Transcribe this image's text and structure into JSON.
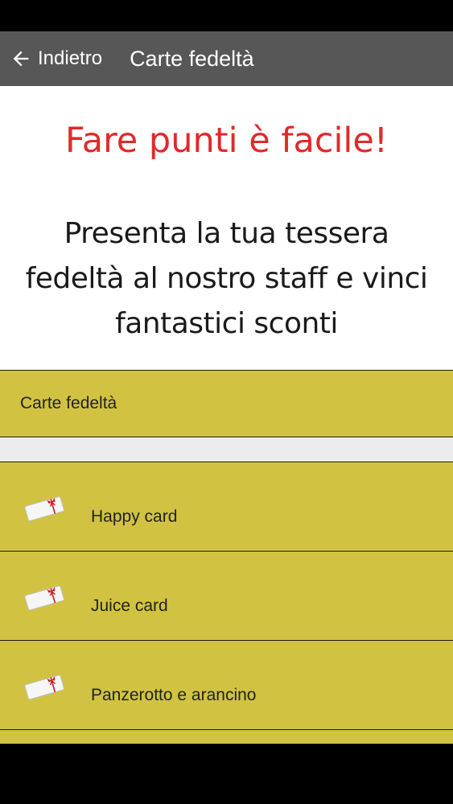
{
  "app_bar": {
    "back_label": "Indietro",
    "title": "Carte fedeltà"
  },
  "banner": {
    "headline": "Fare punti è facile!",
    "body": "Presenta la tua tessera fedeltà al nostro staff e vinci fantastici sconti"
  },
  "section_header": {
    "label": "Carte fedeltà"
  },
  "cards": [
    {
      "label": "Happy card",
      "icon": "gift-card-icon"
    },
    {
      "label": "Juice card",
      "icon": "gift-card-icon"
    },
    {
      "label": "Panzerotto e arancino",
      "icon": "gift-card-icon"
    }
  ],
  "colors": {
    "app_bar": "#575757",
    "accent_yellow": "#d1c341",
    "headline_red": "#e02a2a"
  }
}
